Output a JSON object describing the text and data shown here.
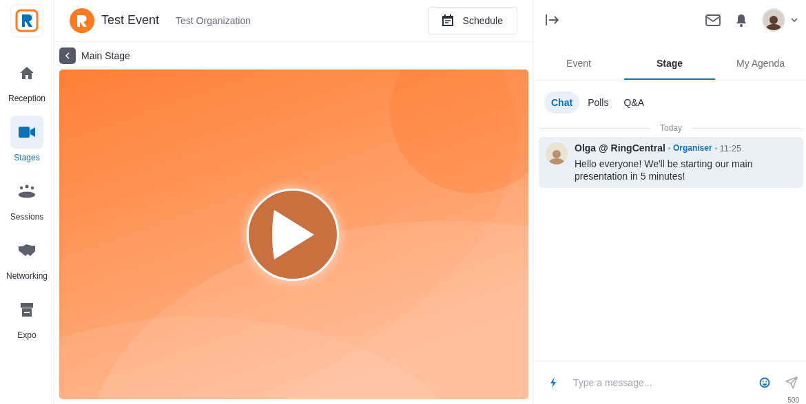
{
  "nav": [
    {
      "label": "Reception",
      "kind": "home",
      "selected": false
    },
    {
      "label": "Stages",
      "kind": "camera",
      "selected": true
    },
    {
      "label": "Sessions",
      "kind": "people",
      "selected": false
    },
    {
      "label": "Networking",
      "kind": "handshake",
      "selected": false
    },
    {
      "label": "Expo",
      "kind": "booth",
      "selected": false
    }
  ],
  "header": {
    "event": "Test Event",
    "organization": "Test Organization",
    "schedule_button": "Schedule"
  },
  "stage": {
    "title": "Main Stage"
  },
  "panel_tabs": [
    {
      "label": "Event",
      "selected": false
    },
    {
      "label": "Stage",
      "selected": true
    },
    {
      "label": "My Agenda",
      "selected": false
    }
  ],
  "sub_tabs": [
    {
      "label": "Chat",
      "selected": true
    },
    {
      "label": "Polls",
      "selected": false
    },
    {
      "label": "Q&A",
      "selected": false
    }
  ],
  "date_divider": "Today",
  "messages": [
    {
      "author": "Olga @ RingCentral",
      "role": "Organiser",
      "time": "11:25",
      "text": "Hello everyone! We'll be starting our main presentation in 5 minutes!"
    }
  ],
  "composer": {
    "placeholder": "Type a message...",
    "counter": "500"
  }
}
